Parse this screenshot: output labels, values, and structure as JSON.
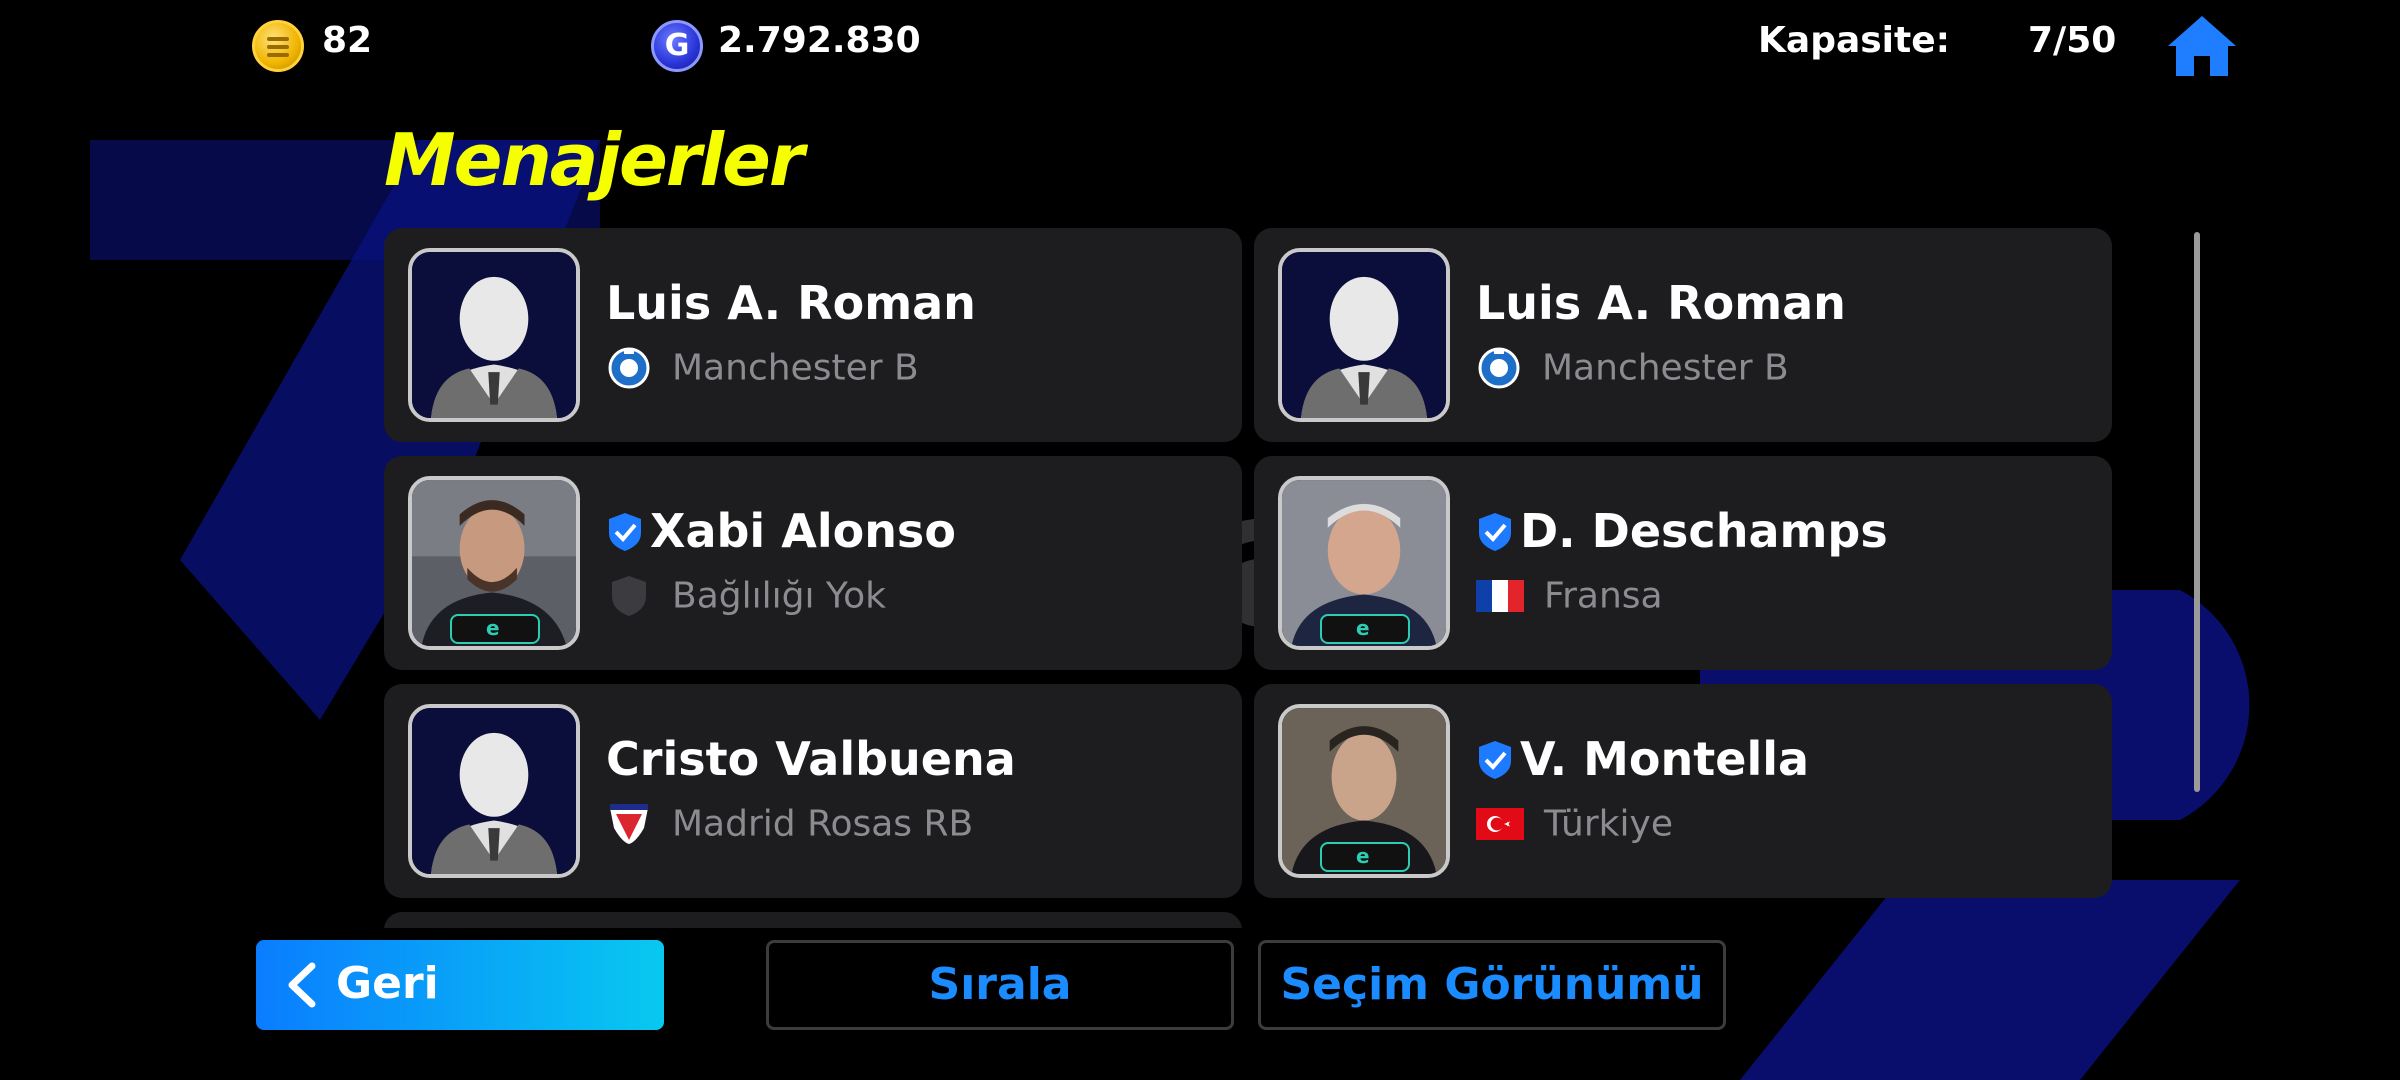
{
  "topbar": {
    "coin_icon": "coin-icon",
    "coins": "82",
    "gp_icon": "gp-icon",
    "gp_glyph": "G",
    "gp": "2.792.830",
    "capacity_label": "Kapasite:",
    "capacity_value": "7/50",
    "home_icon": "home-icon"
  },
  "title": "Menajerler",
  "managers": [
    {
      "name": "Luis A. Roman",
      "sub": "Manchester B",
      "sub_icon": "club-emblem",
      "verified": false,
      "photo": "silhouette"
    },
    {
      "name": "Luis A. Roman",
      "sub": "Manchester B",
      "sub_icon": "club-emblem",
      "verified": false,
      "photo": "silhouette"
    },
    {
      "name": "Xabi Alonso",
      "sub": "Bağlılığı Yok",
      "sub_icon": "shield-icon",
      "verified": true,
      "photo": "portrait"
    },
    {
      "name": "D. Deschamps",
      "sub": "Fransa",
      "sub_icon": "flag-france",
      "verified": true,
      "photo": "portrait"
    },
    {
      "name": "Cristo Valbuena",
      "sub": "Madrid Rosas RB",
      "sub_icon": "club-emblem",
      "verified": false,
      "photo": "silhouette"
    },
    {
      "name": "V. Montella",
      "sub": "Türkiye",
      "sub_icon": "flag-turkey",
      "verified": true,
      "photo": "portrait"
    }
  ],
  "watermark": {
    "main": "itemsatis",
    "small": ".com"
  },
  "buttons": {
    "back": "Geri",
    "sort": "Sırala",
    "view": "Seçim Görünümü"
  },
  "colors": {
    "title": "#f5ff00",
    "accent_blue": "#1a8cff",
    "card_bg": "#1d1d20",
    "bg_shape": "#0a1180"
  }
}
